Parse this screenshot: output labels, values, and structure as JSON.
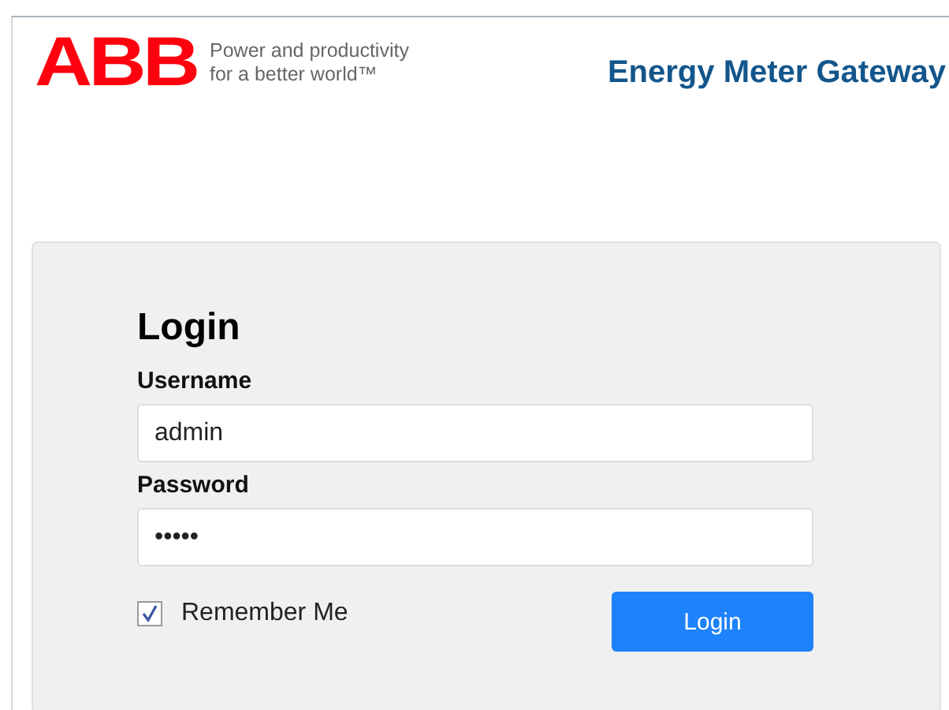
{
  "header": {
    "logo": "ABB",
    "tagline": [
      "Power and productivity",
      "for a better world™"
    ],
    "title": "Energy Meter Gateway"
  },
  "login": {
    "heading": "Login",
    "fields": [
      {
        "label": "Username",
        "value": "admin"
      },
      {
        "label": "Password",
        "value": "•••••"
      }
    ],
    "remember": {
      "label": "Remember Me",
      "checked": true
    },
    "button": "Login"
  }
}
